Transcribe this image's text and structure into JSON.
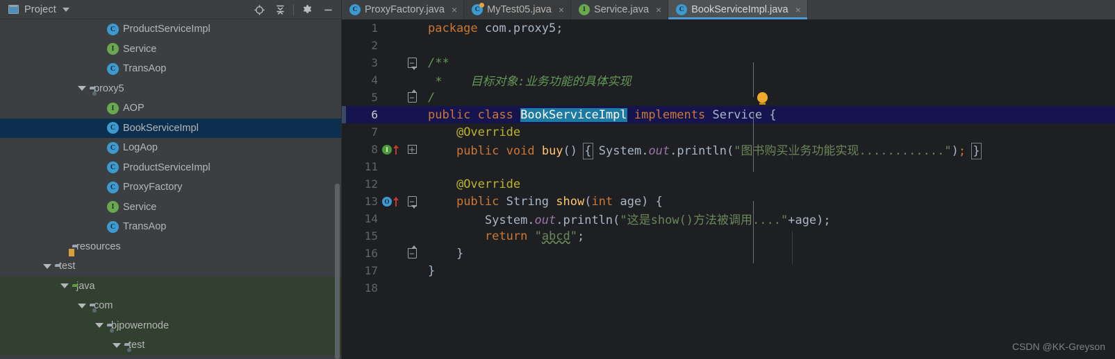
{
  "panel": {
    "title": "Project",
    "icons": [
      "project-window-icon",
      "chevron-down-icon",
      "locate-icon",
      "collapse-all-icon",
      "settings-gear-icon",
      "minimize-icon"
    ],
    "tree": [
      {
        "indent": 5,
        "twisty": "none",
        "icon": "class-icon",
        "label": "ProductServiceImpl",
        "state": "normal"
      },
      {
        "indent": 5,
        "twisty": "none",
        "icon": "interface-icon",
        "label": "Service",
        "state": "normal"
      },
      {
        "indent": 5,
        "twisty": "none",
        "icon": "class-icon",
        "label": "TransAop",
        "state": "normal"
      },
      {
        "indent": 4,
        "twisty": "open",
        "icon": "package-icon",
        "label": "proxy5",
        "state": "normal"
      },
      {
        "indent": 5,
        "twisty": "none",
        "icon": "interface-icon",
        "label": "AOP",
        "state": "normal"
      },
      {
        "indent": 5,
        "twisty": "none",
        "icon": "class-icon",
        "label": "BookServiceImpl",
        "state": "selected"
      },
      {
        "indent": 5,
        "twisty": "none",
        "icon": "class-icon",
        "label": "LogAop",
        "state": "normal"
      },
      {
        "indent": 5,
        "twisty": "none",
        "icon": "class-icon",
        "label": "ProductServiceImpl",
        "state": "normal"
      },
      {
        "indent": 5,
        "twisty": "none",
        "icon": "class-icon",
        "label": "ProxyFactory",
        "state": "normal"
      },
      {
        "indent": 5,
        "twisty": "none",
        "icon": "interface-icon",
        "label": "Service",
        "state": "normal"
      },
      {
        "indent": 5,
        "twisty": "none",
        "icon": "class-icon",
        "label": "TransAop",
        "state": "normal"
      },
      {
        "indent": 3,
        "twisty": "none",
        "icon": "resources-icon",
        "label": "resources",
        "state": "normal"
      },
      {
        "indent": 2,
        "twisty": "open",
        "icon": "folder-icon",
        "label": "test",
        "state": "normal"
      },
      {
        "indent": 3,
        "twisty": "open",
        "icon": "source-root-icon",
        "label": "java",
        "state": "green"
      },
      {
        "indent": 4,
        "twisty": "open",
        "icon": "package-icon",
        "label": "com",
        "state": "green"
      },
      {
        "indent": 5,
        "twisty": "open",
        "icon": "package-icon",
        "label": "bjpowernode",
        "state": "green"
      },
      {
        "indent": 6,
        "twisty": "open",
        "icon": "package-icon",
        "label": "test",
        "state": "green"
      }
    ]
  },
  "tabs": [
    {
      "label": "ProxyFactory.java",
      "icon": "class-icon",
      "active": false,
      "modified": false
    },
    {
      "label": "MyTest05.java",
      "icon": "class-icon",
      "active": false,
      "modified": true
    },
    {
      "label": "Service.java",
      "icon": "interface-icon",
      "active": false,
      "modified": false
    },
    {
      "label": "BookServiceImpl.java",
      "icon": "class-icon",
      "active": true,
      "modified": false
    }
  ],
  "editor": {
    "lines": [
      {
        "n": "1",
        "text": "package com.proxy5;"
      },
      {
        "n": "2",
        "text": ""
      },
      {
        "n": "3",
        "text": "/**"
      },
      {
        "n": "4",
        "text": " *    目标对象:业务功能的具体实现"
      },
      {
        "n": "5",
        "text": " */"
      },
      {
        "n": "6",
        "text": "public class BookServiceImpl implements Service {"
      },
      {
        "n": "7",
        "text": "    @Override"
      },
      {
        "n": "8",
        "text": "    public void buy() { System.out.println(\"图书购买业务功能实现............\"); }"
      },
      {
        "n": "11",
        "text": ""
      },
      {
        "n": "12",
        "text": "    @Override"
      },
      {
        "n": "13",
        "text": "    public String show(int age) {"
      },
      {
        "n": "14",
        "text": "        System.out.println(\"这是show()方法被调用....\"+age);"
      },
      {
        "n": "15",
        "text": "        return \"abcd\";"
      },
      {
        "n": "16",
        "text": "    }"
      },
      {
        "n": "17",
        "text": "}"
      },
      {
        "n": "18",
        "text": ""
      }
    ],
    "selected_text": "BookServiceImpl",
    "highlighted_line": "6",
    "gutter_markers": [
      {
        "line": "8",
        "marker": "implements-method-icon",
        "arrow": "overrides-arrow-icon"
      },
      {
        "line": "13",
        "marker": "overriding-method-icon",
        "arrow": "overrides-arrow-icon"
      }
    ],
    "intention_bulb_line": "5"
  },
  "watermark": "CSDN @KK-Greyson",
  "colors": {
    "panel_bg": "#3c3f41",
    "editor_bg": "#1e1f22",
    "selection_row": "#0d2f4f",
    "source_root_tint": "#31402f",
    "caret_line": "#15144f",
    "text_selection": "#1d7aa2",
    "tab_underline": "#4a9ad4",
    "keyword": "#cc7832",
    "string": "#6a8759",
    "comment": "#629755",
    "annotation": "#bbb529",
    "field": "#9876aa",
    "method": "#ffc66d",
    "identifier": "#a9b7c6"
  }
}
